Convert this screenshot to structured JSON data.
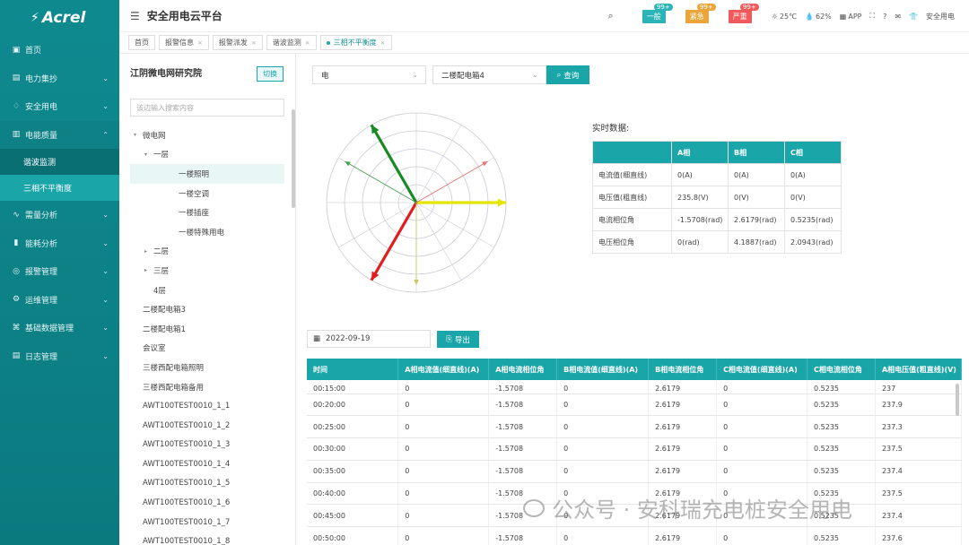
{
  "app": {
    "logo": "Acrel",
    "title": "安全用电云平台"
  },
  "sidebar": {
    "items": [
      {
        "icon": "home-icon",
        "label": "首页",
        "chev": false
      },
      {
        "icon": "meter-icon",
        "label": "电力集抄",
        "chev": true
      },
      {
        "icon": "shield-icon",
        "label": "安全用电",
        "chev": true
      },
      {
        "icon": "quality-icon",
        "label": "电能质量",
        "chev": true
      }
    ],
    "sub_items": [
      {
        "label": "谐波监测"
      },
      {
        "label": "三相不平衡度"
      }
    ],
    "items_after": [
      {
        "icon": "demand-icon",
        "label": "需量分析"
      },
      {
        "icon": "energy-icon",
        "label": "能耗分析"
      },
      {
        "icon": "alarm-icon",
        "label": "报警管理"
      },
      {
        "icon": "ops-icon",
        "label": "运维管理"
      },
      {
        "icon": "data-icon",
        "label": "基础数据管理"
      },
      {
        "icon": "log-icon",
        "label": "日志管理"
      }
    ]
  },
  "topbar": {
    "general": "一般",
    "general_count": "99+",
    "urgent": "紧急",
    "urgent_count": "99+",
    "severe": "严重",
    "severe_count": "99+",
    "temperature": "25℃",
    "humidity": "62%",
    "app": "APP",
    "user": "安全用电"
  },
  "tabs": [
    {
      "label": "首页",
      "close": false,
      "active": false
    },
    {
      "label": "报警信息",
      "close": true,
      "active": false
    },
    {
      "label": "报警派发",
      "close": true,
      "active": false
    },
    {
      "label": "谐波监测",
      "close": true,
      "active": false
    },
    {
      "label": "三相不平衡度",
      "close": true,
      "active": true
    }
  ],
  "tree": {
    "org": "江阴微电网研究院",
    "switch_label": "切换",
    "search_placeholder": "该边输入搜索内容",
    "nodes": [
      {
        "label": "微电网",
        "indent": 0,
        "arrow": "▾",
        "sel": false
      },
      {
        "label": "一层",
        "indent": 1,
        "arrow": "▾",
        "sel": false
      },
      {
        "label": "一楼照明",
        "indent": 2,
        "arrow": "",
        "sel": true
      },
      {
        "label": "一楼空调",
        "indent": 2,
        "arrow": "",
        "sel": false
      },
      {
        "label": "一楼插座",
        "indent": 2,
        "arrow": "",
        "sel": false
      },
      {
        "label": "一楼特殊用电",
        "indent": 2,
        "arrow": "",
        "sel": false
      },
      {
        "label": "二层",
        "indent": 1,
        "arrow": "▸",
        "sel": false
      },
      {
        "label": "三层",
        "indent": 1,
        "arrow": "▸",
        "sel": false
      },
      {
        "label": "4层",
        "indent": 1,
        "arrow": "",
        "sel": false
      },
      {
        "label": "二楼配电箱3",
        "indent": 0,
        "arrow": "",
        "sel": false
      },
      {
        "label": "二楼配电箱1",
        "indent": 0,
        "arrow": "",
        "sel": false
      },
      {
        "label": "会议室",
        "indent": 0,
        "arrow": "",
        "sel": false
      },
      {
        "label": "三楼西配电箱照明",
        "indent": 0,
        "arrow": "",
        "sel": false
      },
      {
        "label": "三楼西配电箱备用",
        "indent": 0,
        "arrow": "",
        "sel": false
      },
      {
        "label": "AWT100TEST0010_1_1",
        "indent": 0,
        "arrow": "",
        "sel": false
      },
      {
        "label": "AWT100TEST0010_1_2",
        "indent": 0,
        "arrow": "",
        "sel": false
      },
      {
        "label": "AWT100TEST0010_1_3",
        "indent": 0,
        "arrow": "",
        "sel": false
      },
      {
        "label": "AWT100TEST0010_1_4",
        "indent": 0,
        "arrow": "",
        "sel": false
      },
      {
        "label": "AWT100TEST0010_1_5",
        "indent": 0,
        "arrow": "",
        "sel": false
      },
      {
        "label": "AWT100TEST0010_1_6",
        "indent": 0,
        "arrow": "",
        "sel": false
      },
      {
        "label": "AWT100TEST0010_1_7",
        "indent": 0,
        "arrow": "",
        "sel": false
      },
      {
        "label": "AWT100TEST0010_1_8",
        "indent": 0,
        "arrow": "",
        "sel": false
      }
    ]
  },
  "filters": {
    "type": "电",
    "device": "二楼配电箱4",
    "query": "查询"
  },
  "phasor": {
    "vectors": [
      {
        "phase": "A",
        "kind": "voltage",
        "angle_rad": 0,
        "color": "#e4e600"
      },
      {
        "phase": "B",
        "kind": "voltage",
        "angle_rad": 4.1887,
        "color": "#e21d1d"
      },
      {
        "phase": "C",
        "kind": "voltage",
        "angle_rad": 2.0943,
        "color": "#188a23"
      },
      {
        "phase": "A",
        "kind": "current",
        "angle_rad": -1.5708,
        "color": "#c9c96a"
      },
      {
        "phase": "B",
        "kind": "current",
        "angle_rad": 2.6179,
        "color": "#4f9e58"
      },
      {
        "phase": "C",
        "kind": "current",
        "angle_rad": 0.5235,
        "color": "#e27575"
      }
    ]
  },
  "realtime": {
    "label": "实时数据:",
    "headers": [
      "",
      "A相",
      "B相",
      "C相"
    ],
    "rows": [
      {
        "name": "电流值(细直线)",
        "a": "0(A)",
        "b": "0(A)",
        "c": "0(A)"
      },
      {
        "name": "电压值(粗直线)",
        "a": "235.8(V)",
        "b": "0(V)",
        "c": "0(V)"
      },
      {
        "name": "电流相位角",
        "a": "-1.5708(rad)",
        "b": "2.6179(rad)",
        "c": "0.5235(rad)"
      },
      {
        "name": "电压相位角",
        "a": "0(rad)",
        "b": "4.1887(rad)",
        "c": "2.0943(rad)"
      }
    ]
  },
  "history": {
    "date": "2022-09-19",
    "export": "导出",
    "headers": [
      "时间",
      "A相电流值(细直线)(A)",
      "A相电流相位角",
      "B相电流值(细直线)(A)",
      "B相电流相位角",
      "C相电流值(细直线)(A)",
      "C相电流相位角",
      "A相电压值(粗直线)(V)"
    ],
    "rows": [
      {
        "t": "00:15:00",
        "ia": "0",
        "pa": "-1.5708",
        "ib": "0",
        "pb": "2.6179",
        "ic": "0",
        "pc": "0.5235",
        "va": "237"
      },
      {
        "t": "00:20:00",
        "ia": "0",
        "pa": "-1.5708",
        "ib": "0",
        "pb": "2.6179",
        "ic": "0",
        "pc": "0.5235",
        "va": "237.9"
      },
      {
        "t": "00:25:00",
        "ia": "0",
        "pa": "-1.5708",
        "ib": "0",
        "pb": "2.6179",
        "ic": "0",
        "pc": "0.5235",
        "va": "237.3"
      },
      {
        "t": "00:30:00",
        "ia": "0",
        "pa": "-1.5708",
        "ib": "0",
        "pb": "2.6179",
        "ic": "0",
        "pc": "0.5235",
        "va": "237.5"
      },
      {
        "t": "00:35:00",
        "ia": "0",
        "pa": "-1.5708",
        "ib": "0",
        "pb": "2.6179",
        "ic": "0",
        "pc": "0.5235",
        "va": "237.4"
      },
      {
        "t": "00:40:00",
        "ia": "0",
        "pa": "-1.5708",
        "ib": "0",
        "pb": "2.6179",
        "ic": "0",
        "pc": "0.5235",
        "va": "237.5"
      },
      {
        "t": "00:45:00",
        "ia": "0",
        "pa": "-1.5708",
        "ib": "0",
        "pb": "2.6179",
        "ic": "0",
        "pc": "0.5235",
        "va": "237.4"
      },
      {
        "t": "00:50:00",
        "ia": "0",
        "pa": "-1.5708",
        "ib": "0",
        "pb": "2.6179",
        "ic": "0",
        "pc": "0.5235",
        "va": "237.6"
      }
    ]
  },
  "watermark": "公众号 · 安科瑞充电桩安全用电"
}
